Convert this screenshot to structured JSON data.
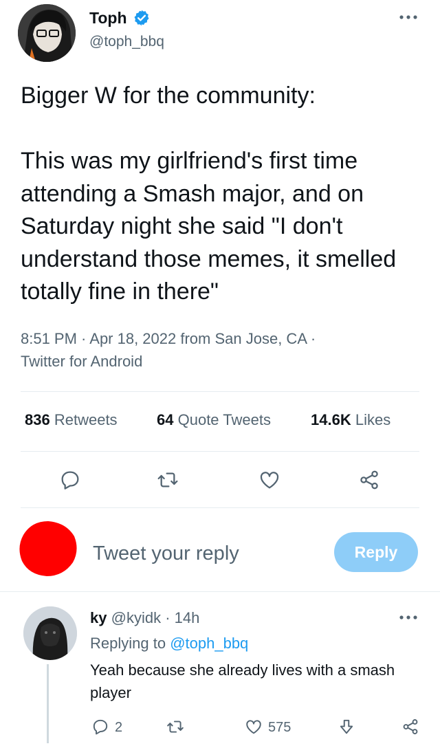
{
  "tweet": {
    "author_name": "Toph",
    "author_handle": "@toph_bbq",
    "text": "Bigger W for the community:\n\nThis was my girlfriend's first time attending a Smash major, and on Saturday night she said \"I don't understand those memes, it smelled totally fine in there\"",
    "meta": "8:51 PM · Apr 18, 2022 from San Jose, CA · Twitter for Android",
    "stats": {
      "retweets_count": "836",
      "retweets_label": "Retweets",
      "quotes_count": "64",
      "quotes_label": "Quote Tweets",
      "likes_count": "14.6K",
      "likes_label": "Likes"
    },
    "actions": [
      "reply-icon",
      "retweet-icon",
      "like-icon",
      "share-icon"
    ]
  },
  "composer": {
    "placeholder": "Tweet your reply",
    "button_label": "Reply"
  },
  "reply": {
    "name": "ky",
    "handle": "@kyidk",
    "time": "· 14h",
    "replying_prefix": "Replying to",
    "replying_to": "@toph_bbq",
    "text": "Yeah because she already lives with a smash player",
    "reply_count": "2",
    "like_count": "575",
    "actions": [
      "reply-icon",
      "retweet-icon",
      "like-icon",
      "downvote-icon",
      "share-icon"
    ]
  },
  "colors": {
    "accent": "#1d9bf0",
    "reply_button_disabled": "#8ecdf8",
    "muted_text": "#536471",
    "redacted_avatar": "#ff0000"
  }
}
